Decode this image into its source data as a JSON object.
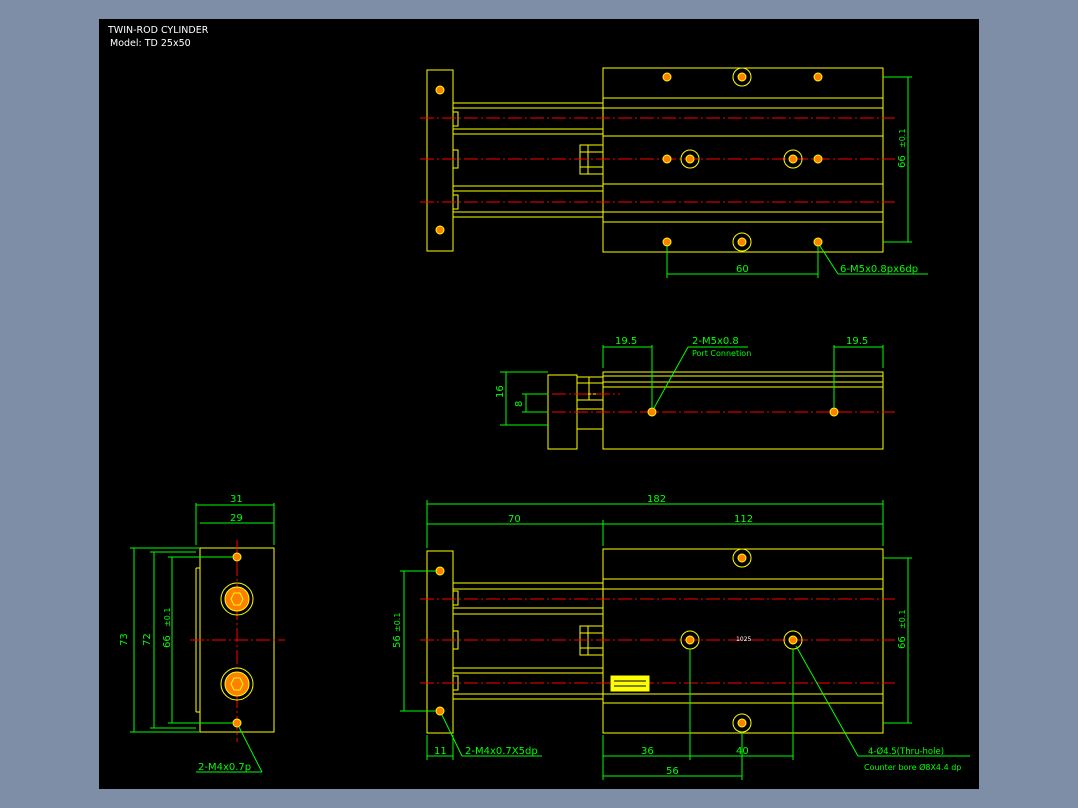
{
  "title_block": {
    "line1": "TWIN-ROD CYLINDER",
    "line2": "Model:  TD 25x50"
  },
  "colors": {
    "outline": "#ffff00",
    "centerline": "#ff0000",
    "dimension": "#00ff00",
    "hole_fill": "#ff7f00",
    "background": "#000000",
    "frame": "#7d8ea6"
  },
  "top_view": {
    "dim_66": "66",
    "tol": "±0.1",
    "dim_60": "60",
    "holes_callout": "6-M5x0.8px6dp"
  },
  "side_view": {
    "dim_19_5_left": "19.5",
    "dim_19_5_right": "19.5",
    "port_callout": "2-M5x0.8",
    "port_note": "Port Connetion",
    "dim_16": "16",
    "dim_8": "8"
  },
  "end_view": {
    "dim_31": "31",
    "dim_29": "29",
    "dim_73": "73",
    "dim_72": "72",
    "dim_66": "66",
    "tol": "±0.1",
    "holes_callout": "2-M4x0.7p"
  },
  "front_view": {
    "dim_182": "182",
    "dim_70": "70",
    "dim_112": "112",
    "dim_56_left": "56",
    "tol": "±0.1",
    "dim_66_right": "66",
    "dim_11": "11",
    "holes_callout": "2-M4x0.7X5dp",
    "dim_36": "36",
    "dim_40": "40",
    "dim_56_bottom": "56",
    "thru_callout": "4-Ø4.5(Thru-hole)",
    "counter_callout": "Counter bore Ø8X4.4 dp",
    "model_mark": "1025"
  }
}
